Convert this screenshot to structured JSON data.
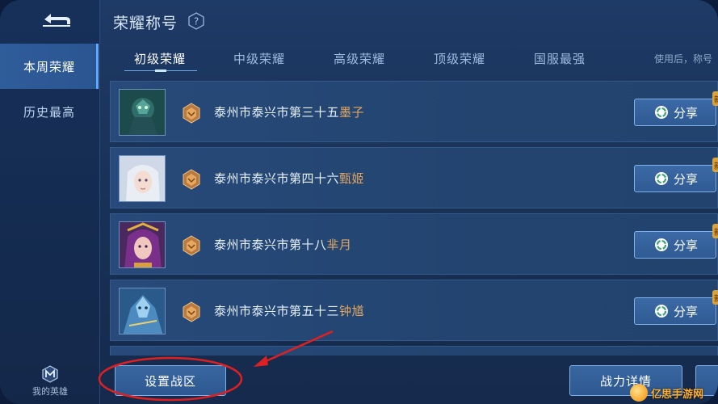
{
  "colors": {
    "background": "#193258",
    "accent": "#5fa8ff",
    "hero_name": "#e0a562",
    "annotation": "#e02020"
  },
  "sidebar": {
    "items": [
      {
        "label": "本周荣耀",
        "active": true
      },
      {
        "label": "历史最高",
        "active": false
      }
    ],
    "hero_nav_label": "我的英雄"
  },
  "header": {
    "title": "荣耀称号",
    "help_icon": "question-icon",
    "tip": "使用后，称号"
  },
  "tabs": [
    {
      "label": "初级荣耀",
      "active": true
    },
    {
      "label": "中级荣耀",
      "active": false
    },
    {
      "label": "高级荣耀",
      "active": false
    },
    {
      "label": "顶级荣耀",
      "active": false
    },
    {
      "label": "国服最强",
      "active": false
    }
  ],
  "rows": [
    {
      "location": "泰州市泰兴市第三十五",
      "hero": "墨子",
      "share_label": "分享",
      "new_badge": "新"
    },
    {
      "location": "泰州市泰兴市第四十六",
      "hero": "甄姬",
      "share_label": "分享",
      "new_badge": "新"
    },
    {
      "location": "泰州市泰兴市第十八",
      "hero": "芈月",
      "share_label": "分享",
      "new_badge": "新"
    },
    {
      "location": "泰州市泰兴市第五十三",
      "hero": "钟馗",
      "share_label": "分享",
      "new_badge": "新"
    }
  ],
  "footer": {
    "set_zone_label": "设置战区",
    "power_detail_label": "战力详情"
  },
  "watermark": {
    "text": "亿思手游网"
  }
}
